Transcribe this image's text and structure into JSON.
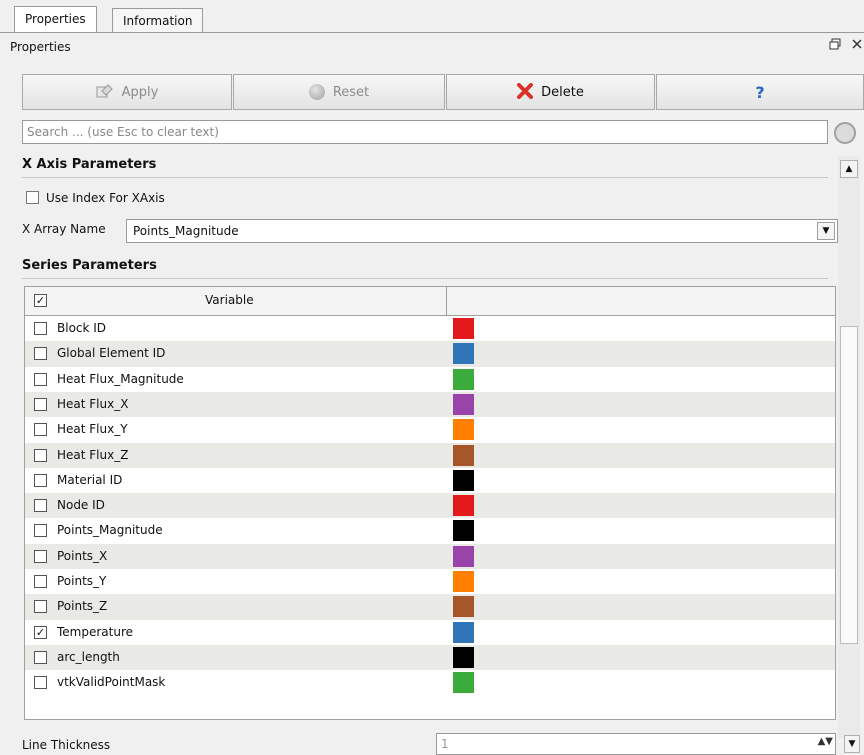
{
  "tabs": [
    {
      "label": "Properties",
      "active": true
    },
    {
      "label": "Information",
      "active": false
    }
  ],
  "panel": {
    "title": "Properties",
    "float_glyph": "ə",
    "close_glyph": "×"
  },
  "toolbar": {
    "apply_label": "Apply",
    "reset_label": "Reset",
    "delete_label": "Delete",
    "help_label": "?"
  },
  "search": {
    "placeholder": "Search ... (use Esc to clear text)",
    "value": ""
  },
  "x_axis": {
    "heading": "X Axis Parameters",
    "use_index_label": "Use Index For XAxis",
    "use_index_checked": false,
    "array_name_label": "X Array Name",
    "array_name_value": "Points_Magnitude"
  },
  "series": {
    "heading": "Series Parameters",
    "header_variable": "Variable",
    "header_checked": true,
    "rows": [
      {
        "name": "Block ID",
        "checked": false,
        "color": "#e31a1c"
      },
      {
        "name": "Global Element ID",
        "checked": false,
        "color": "#2f75b8"
      },
      {
        "name": "Heat Flux_Magnitude",
        "checked": false,
        "color": "#3bab3b"
      },
      {
        "name": "Heat Flux_X",
        "checked": false,
        "color": "#9844a8"
      },
      {
        "name": "Heat Flux_Y",
        "checked": false,
        "color": "#ff7f00"
      },
      {
        "name": "Heat Flux_Z",
        "checked": false,
        "color": "#a65628"
      },
      {
        "name": "Material ID",
        "checked": false,
        "color": "#000000"
      },
      {
        "name": "Node ID",
        "checked": false,
        "color": "#e31a1c"
      },
      {
        "name": "Points_Magnitude",
        "checked": false,
        "color": "#000000"
      },
      {
        "name": "Points_X",
        "checked": false,
        "color": "#9844a8"
      },
      {
        "name": "Points_Y",
        "checked": false,
        "color": "#ff7f00"
      },
      {
        "name": "Points_Z",
        "checked": false,
        "color": "#a65628"
      },
      {
        "name": "Temperature",
        "checked": true,
        "color": "#2f75b8"
      },
      {
        "name": "arc_length",
        "checked": false,
        "color": "#000000"
      },
      {
        "name": "vtkValidPointMask",
        "checked": false,
        "color": "#3bab3b"
      }
    ]
  },
  "line_thickness": {
    "label": "Line Thickness",
    "value": "1"
  },
  "colors": {
    "delete_icon": "#d9342b",
    "help_icon": "#2a64c5",
    "disabled_text": "#8a8a8a"
  }
}
